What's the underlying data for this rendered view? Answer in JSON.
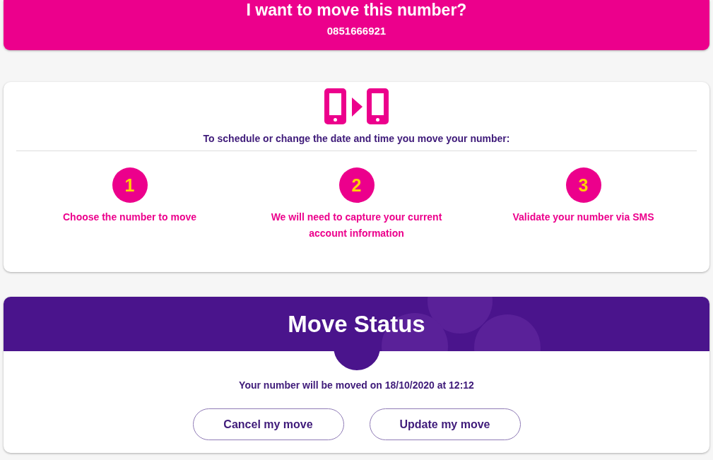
{
  "number_header": {
    "title": "I want to move this number?",
    "number": "0851666921"
  },
  "steps_card": {
    "intro": "To schedule or change the date and time you move your number:",
    "steps": [
      {
        "number": "1",
        "label": "Choose the number to move"
      },
      {
        "number": "2",
        "label": "We will need to capture your current account information"
      },
      {
        "number": "3",
        "label": "Validate your number via SMS"
      }
    ]
  },
  "move_status": {
    "title": "Move Status",
    "message": "Your number will be moved on 18/10/2020 at 12:12",
    "buttons": [
      "Cancel my move",
      "Update my move"
    ]
  }
}
